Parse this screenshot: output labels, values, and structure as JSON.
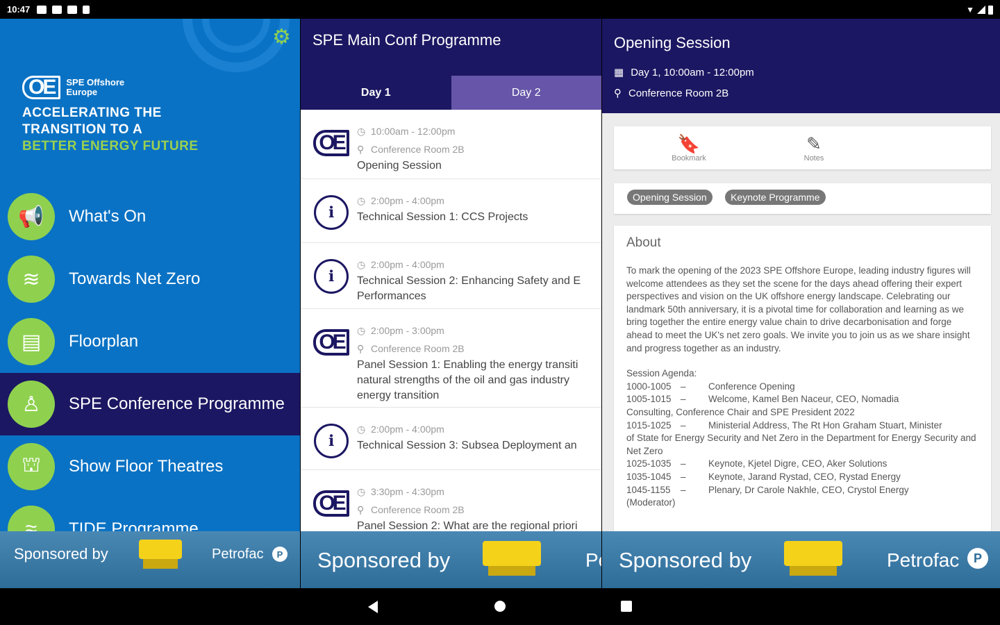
{
  "status_bar": {
    "time": "10:47"
  },
  "drawer": {
    "logo_mark": "OE",
    "logo_name": "SPE Offshore Europe",
    "tagline_line1": "ACCELERATING THE",
    "tagline_line2": "TRANSITION TO A",
    "tagline_line3": "BETTER ENERGY FUTURE",
    "settings_icon": "gear-icon",
    "menu": [
      {
        "label": "What's On",
        "icon": "megaphone-icon"
      },
      {
        "label": "Towards Net Zero",
        "icon": "net-zero-icon"
      },
      {
        "label": "Floorplan",
        "icon": "floorplan-icon"
      },
      {
        "label": "SPE Conference Programme",
        "icon": "conference-icon",
        "active": true
      },
      {
        "label": "Show Floor Theatres",
        "icon": "theatre-icon"
      },
      {
        "label": "TIDE Programme",
        "icon": "tide-icon"
      }
    ],
    "sponsor_text": "Sponsored by",
    "sponsor_brand": "Petrofac"
  },
  "programme": {
    "title": "SPE Main Conf Programme",
    "tabs": [
      {
        "label": "Day 1"
      },
      {
        "label": "Day 2"
      }
    ],
    "selected_tab": "Day 2",
    "sessions": [
      {
        "time": "10:00am - 12:00pm",
        "room": "Conference Room 2B",
        "name": "Opening Session",
        "logo": "oe-logo"
      },
      {
        "time": "2:00pm - 4:00pm",
        "room": "",
        "name": "Technical Session 1: CCS Projects",
        "logo": "presenter-icon"
      },
      {
        "time": "2:00pm - 4:00pm",
        "room": "",
        "name": "Technical Session 2: Enhancing Safety and E",
        "name2": "Performances",
        "logo": "presenter-icon"
      },
      {
        "time": "2:00pm - 3:00pm",
        "room": "Conference Room 2B",
        "name": "Panel Session 1: Enabling the energy transiti",
        "name2": "natural strengths of the oil and gas industry",
        "name3": "energy transition",
        "logo": "oe-logo"
      },
      {
        "time": "2:00pm - 4:00pm",
        "room": "",
        "name": "Technical Session 3: Subsea Deployment an",
        "logo": "presenter-icon"
      },
      {
        "time": "3:30pm - 4:30pm",
        "room": "Conference Room 2B",
        "name": "Panel Session 2: What are the regional priori",
        "logo": "oe-logo"
      }
    ],
    "sponsor_text": "Sponsored by",
    "sponsor_brand": "Pe"
  },
  "detail": {
    "title": "Opening Session",
    "when": "Day 1, 10:00am - 12:00pm",
    "where": "Conference Room 2B",
    "actions": {
      "bookmark": "Bookmark",
      "notes": "Notes"
    },
    "tags": [
      "Opening Session",
      "Keynote Programme"
    ],
    "about_title": "About",
    "about_text": "To mark the opening of the 2023 SPE Offshore Europe, leading industry figures will welcome attendees as they set the scene for the days ahead offering their expert perspectives and vision on the UK offshore energy landscape. Celebrating our landmark 50th anniversary, it is a pivotal time for collaboration and learning as we bring together the entire energy value chain to drive decarbonisation and forge ahead to meet the UK's net zero goals. We invite you to join us as we share insight and progress together as an industry.",
    "agenda_title": "Session Agenda:",
    "agenda": [
      {
        "time": "1000-1005",
        "text": "Conference Opening",
        "cont": ""
      },
      {
        "time": "1005-1015",
        "text": "Welcome, Kamel Ben Naceur, CEO, Nomadia",
        "cont": "Consulting, Conference Chair and SPE President 2022"
      },
      {
        "time": "1015-1025",
        "text": "Ministerial Address, The Rt Hon Graham Stuart, Minister",
        "cont": "of State for Energy Security and Net Zero in the Department for Energy Security and Net Zero"
      },
      {
        "time": "1025-1035",
        "text": "Keynote, Kjetel Digre, CEO, Aker Solutions",
        "cont": ""
      },
      {
        "time": "1035-1045",
        "text": "Keynote, Jarand Rystad, CEO, Rystad Energy",
        "cont": ""
      },
      {
        "time": "1045-1155",
        "text": "Plenary, Dr Carole Nakhle, CEO, Crystol Energy",
        "cont": "(Moderator)"
      }
    ],
    "sponsor_text": "Sponsored by",
    "sponsor_brand": "Petrofac"
  },
  "colors": {
    "navy": "#1c1762",
    "drawer_blue": "#0a72c4",
    "lime": "#8fd14f",
    "tab_purple": "#6655a8"
  }
}
